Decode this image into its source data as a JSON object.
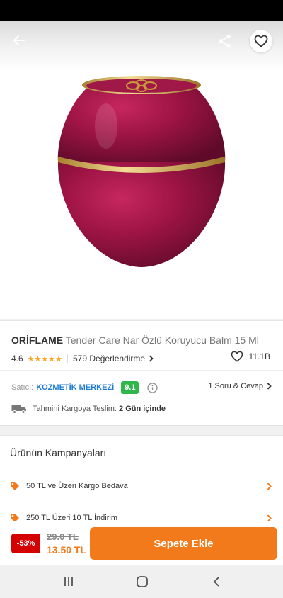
{
  "header": {
    "back_icon": "arrow-left-icon",
    "share_icon": "share-icon",
    "favorite_icon": "heart-outline-icon"
  },
  "product": {
    "brand": "ORİFLAME",
    "name": "Tender Care Nar Özlü Koruyucu Balm 15 Ml",
    "rating": "4.6",
    "stars": "★★★★★",
    "review_count": "579 Değerlendirme",
    "likes": "11.1B"
  },
  "seller": {
    "label": "Satıcı:",
    "name": "KOZMETİK MERKEZİ",
    "score": "9.1",
    "qa_link": "1 Soru & Cevap"
  },
  "shipping": {
    "label": "Tahmini Kargoya Teslim:",
    "days": "2 Gün içinde"
  },
  "campaigns": {
    "title": "Ürünün Kampanyaları",
    "items": [
      {
        "label": "50 TL ve Üzeri Kargo Bedava"
      },
      {
        "label": "250 TL Üzeri 10 TL İndirim"
      }
    ]
  },
  "purchase": {
    "discount": "-53%",
    "old_price": "29.0 TL",
    "new_price": "13.50 TL",
    "add_to_cart": "Sepete Ekle"
  },
  "colors": {
    "accent": "#f27a1a",
    "discount_red": "#d50000",
    "seller_blue": "#1d7bd1",
    "score_green": "#2eb84b",
    "product_maroon": "#8b0f3a",
    "gold": "#d9b45a"
  }
}
